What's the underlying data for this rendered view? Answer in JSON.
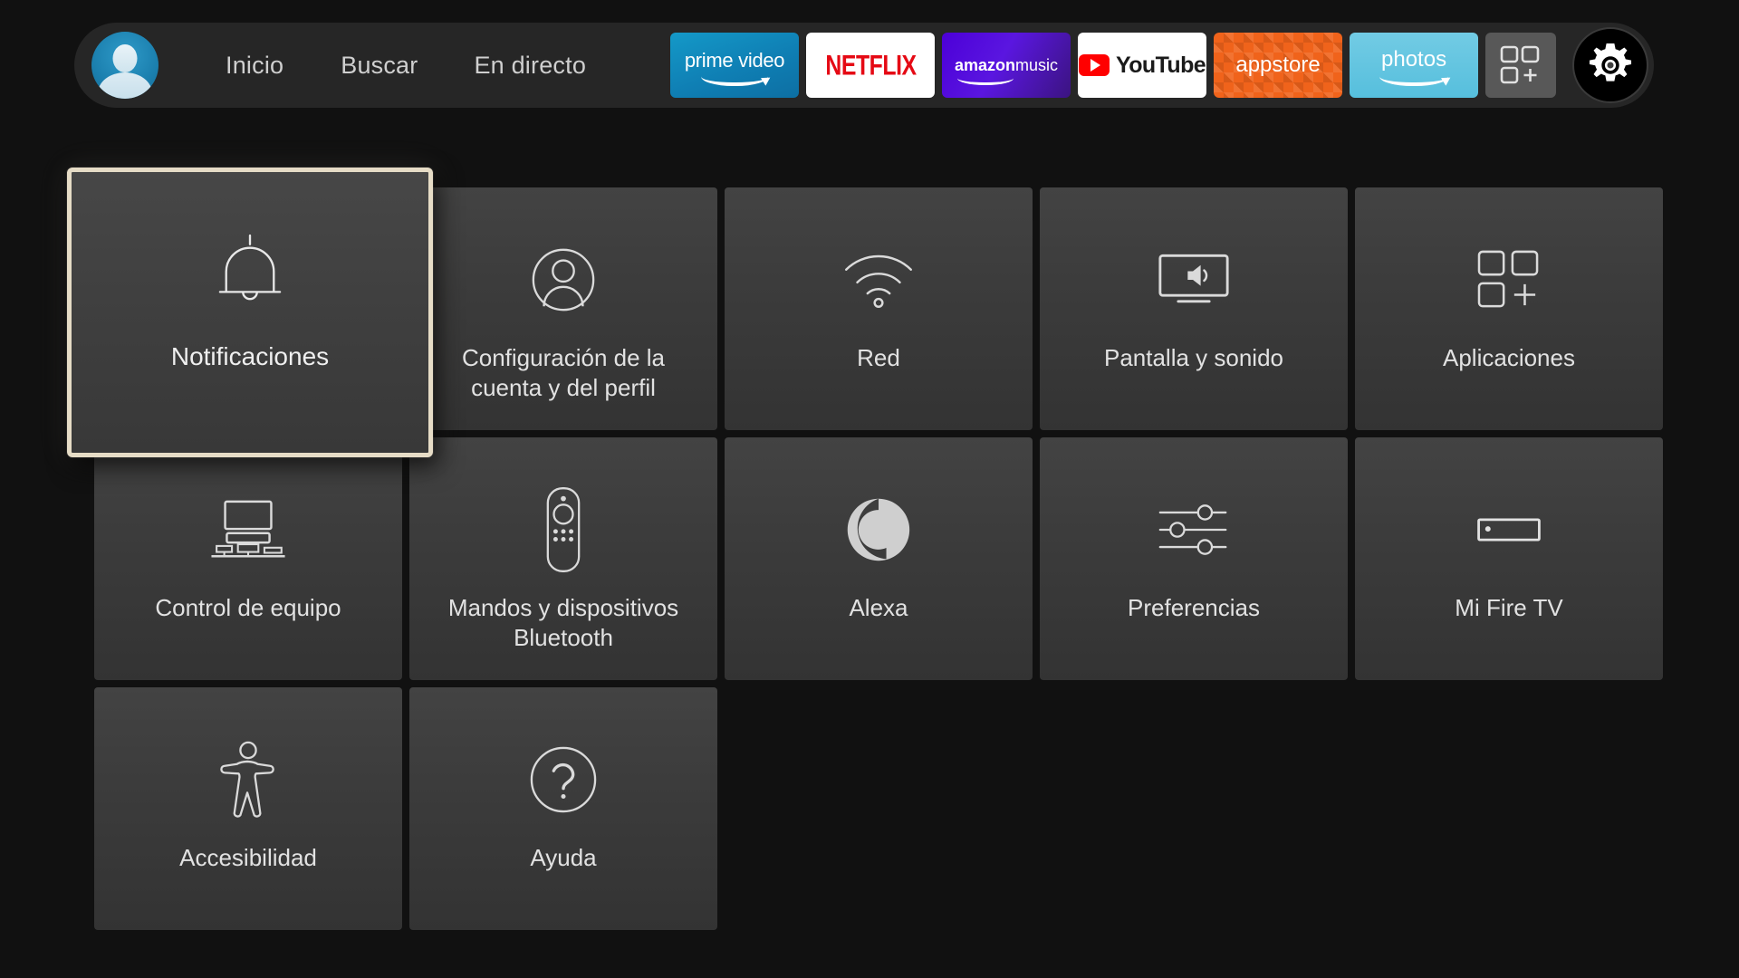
{
  "header": {
    "avatar_name": "profile-avatar",
    "nav": [
      {
        "id": "inicio",
        "label": "Inicio"
      },
      {
        "id": "buscar",
        "label": "Buscar"
      },
      {
        "id": "endirecto",
        "label": "En directo"
      }
    ],
    "apps": [
      {
        "id": "prime",
        "label": "prime video",
        "bg": "#0f8fc0"
      },
      {
        "id": "netflix",
        "label": "NETFLIX",
        "bg": "#ffffff",
        "fg": "#e50914"
      },
      {
        "id": "music_amazon",
        "label": "amazon",
        "music_label": "music",
        "bg": "#4c00d8"
      },
      {
        "id": "youtube",
        "label": "YouTube",
        "bg": "#ffffff",
        "fg": "#1a1a1a"
      },
      {
        "id": "appstore",
        "label": "appstore",
        "bg": "#f0631b"
      },
      {
        "id": "photos",
        "label": "photos",
        "bg": "#56bfdd"
      }
    ],
    "apps_grid_button": "apps-grid-button",
    "settings_button": "settings-gear-button"
  },
  "grid": {
    "rows": [
      [
        {
          "id": "notificaciones",
          "label": "Notificaciones",
          "icon": "bell-icon",
          "focused": true
        },
        {
          "id": "cuenta",
          "label": "Configuración de la cuenta y del perfil",
          "icon": "person-circle-icon",
          "focused": false
        },
        {
          "id": "red",
          "label": "Red",
          "icon": "wifi-icon",
          "focused": false
        },
        {
          "id": "pantalla",
          "label": "Pantalla y sonido",
          "icon": "tv-speaker-icon",
          "focused": false
        },
        {
          "id": "aplicaciones",
          "label": "Aplicaciones",
          "icon": "apps-squares-icon",
          "focused": false
        }
      ],
      [
        {
          "id": "control",
          "label": "Control de equipo",
          "icon": "home-theater-icon",
          "focused": false
        },
        {
          "id": "mandos",
          "label": "Mandos y dispositivos Bluetooth",
          "icon": "remote-control-icon",
          "focused": false
        },
        {
          "id": "alexa",
          "label": "Alexa",
          "icon": "alexa-ring-icon",
          "focused": false
        },
        {
          "id": "preferencias",
          "label": "Preferencias",
          "icon": "sliders-icon",
          "focused": false
        },
        {
          "id": "mifiretv",
          "label": "Mi Fire TV",
          "icon": "firetv-device-icon",
          "focused": false
        }
      ],
      [
        {
          "id": "accesibilidad",
          "label": "Accesibilidad",
          "icon": "accessibility-person-icon",
          "focused": false
        },
        {
          "id": "ayuda",
          "label": "Ayuda",
          "icon": "question-circle-icon",
          "focused": false
        }
      ]
    ]
  },
  "colors": {
    "background": "#111111",
    "tile": "#3b3b3b",
    "focus_border": "#e6dcc6",
    "text": "#e2e2e2",
    "nav_text": "#cfcfcf"
  }
}
